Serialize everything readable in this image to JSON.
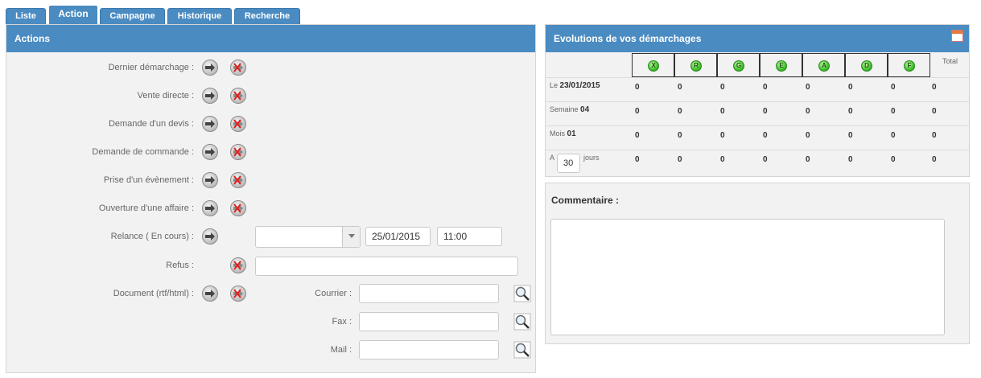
{
  "tabs": [
    {
      "label": "Liste"
    },
    {
      "label": "Action"
    },
    {
      "label": "Campagne"
    },
    {
      "label": "Historique"
    },
    {
      "label": "Recherche"
    }
  ],
  "actions_panel": {
    "title": "Actions",
    "rows": [
      {
        "label": "Dernier démarchage :"
      },
      {
        "label": "Vente directe :"
      },
      {
        "label": "Demande d'un devis :"
      },
      {
        "label": "Demande de commande :"
      },
      {
        "label": "Prise d'un évènement :"
      },
      {
        "label": "Ouverture d'une affaire :"
      },
      {
        "label": "Relance ( En cours) :"
      },
      {
        "label": "Refus :"
      },
      {
        "label": "Document (rtf/html) :"
      }
    ],
    "relance": {
      "select_value": "",
      "date_value": "25/01/2015",
      "time_value": "11:00"
    },
    "refus_value": "",
    "document": {
      "courrier_label": "Courrier :",
      "fax_label": "Fax :",
      "mail_label": "Mail :",
      "courrier_value": "",
      "fax_value": "",
      "mail_value": ""
    }
  },
  "evolutions_panel": {
    "title": "Evolutions de vos démarchages",
    "status_columns": [
      "X",
      "R",
      "G",
      "E",
      "A",
      "D",
      "F"
    ],
    "total_label": "Total",
    "rows": [
      {
        "prefix": "Le",
        "value": "23/01/2015",
        "counts": [
          "0",
          "0",
          "0",
          "0",
          "0",
          "0",
          "0",
          "0"
        ]
      },
      {
        "prefix": "Semaine",
        "value": "04",
        "counts": [
          "0",
          "0",
          "0",
          "0",
          "0",
          "0",
          "0",
          "0"
        ]
      },
      {
        "prefix": "Mois",
        "value": "01",
        "counts": [
          "0",
          "0",
          "0",
          "0",
          "0",
          "0",
          "0",
          "0"
        ]
      },
      {
        "prefix": "A",
        "days_input": "30",
        "suffix": "jours",
        "counts": [
          "0",
          "0",
          "0",
          "0",
          "0",
          "0",
          "0",
          "0"
        ]
      }
    ]
  },
  "comment_panel": {
    "title": "Commentaire :",
    "value": ""
  },
  "icons": {
    "go": "arrow-right-icon",
    "cancel": "red-x-icon",
    "search": "magnifier-icon",
    "calendar": "calendar-icon"
  },
  "colors": {
    "header_blue": "#4a8bc2",
    "panel_bg": "#f2f2f2",
    "status_green": "#3fbf2b"
  }
}
